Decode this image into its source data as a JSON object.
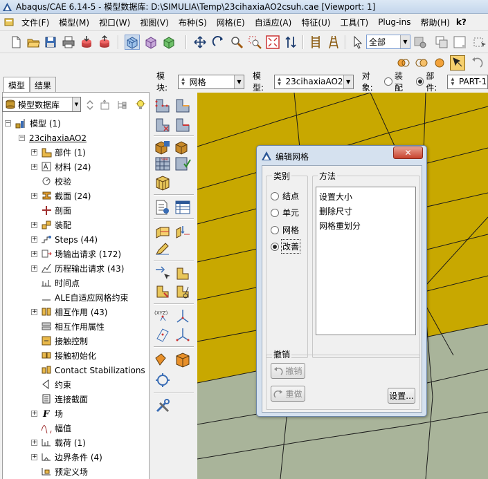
{
  "window": {
    "title": "Abaqus/CAE 6.14-5 - 模型数据库: D:\\SIMULIA\\Temp\\23cihaxiaAO2csuh.cae [Viewport: 1]"
  },
  "menu": {
    "items": [
      "文件(F)",
      "模型(M)",
      "视口(W)",
      "视图(V)",
      "布种(S)",
      "网格(E)",
      "自适应(A)",
      "特征(U)",
      "工具(T)",
      "Plug-ins",
      "帮助(H)"
    ],
    "whats_this": "k?"
  },
  "toolbar": {
    "selection_filter": "全部"
  },
  "left_tabs": [
    "模型",
    "结果"
  ],
  "tree_selector": "模型数据库",
  "tree": {
    "root": "模型 (1)",
    "model": "23cihaxiaAO2",
    "items": [
      {
        "label": "部件 (1)",
        "icon": "part-icon",
        "expandable": true
      },
      {
        "label": "材料 (24)",
        "icon": "material-icon",
        "expandable": true
      },
      {
        "label": "校验",
        "icon": "calibration-icon",
        "expandable": false
      },
      {
        "label": "截面 (24)",
        "icon": "section-icon",
        "expandable": true
      },
      {
        "label": "剖面",
        "icon": "profile-icon",
        "expandable": false
      },
      {
        "label": "装配",
        "icon": "assembly-icon",
        "expandable": true
      },
      {
        "label": "Steps (44)",
        "icon": "steps-icon",
        "expandable": true
      },
      {
        "label": "场输出请求 (172)",
        "icon": "field-output-icon",
        "expandable": true
      },
      {
        "label": "历程输出请求 (43)",
        "icon": "history-output-icon",
        "expandable": true
      },
      {
        "label": "时间点",
        "icon": "time-points-icon",
        "expandable": false
      },
      {
        "label": "ALE自适应网格约束",
        "icon": "ale-icon",
        "expandable": false
      },
      {
        "label": "相互作用  (43)",
        "icon": "interaction-icon",
        "expandable": true
      },
      {
        "label": "相互作用属性",
        "icon": "interaction-property-icon",
        "expandable": false
      },
      {
        "label": "接触控制",
        "icon": "contact-control-icon",
        "expandable": false
      },
      {
        "label": "接触初始化",
        "icon": "contact-init-icon",
        "expandable": false
      },
      {
        "label": "Contact Stabilizations",
        "icon": "contact-stabilization-icon",
        "expandable": false
      },
      {
        "label": "约束",
        "icon": "constraint-icon",
        "expandable": false
      },
      {
        "label": "连接截面",
        "icon": "connector-section-icon",
        "expandable": false
      },
      {
        "label": "场",
        "icon": "field-icon",
        "expandable": true
      },
      {
        "label": "幅值",
        "icon": "amplitude-icon",
        "expandable": false
      },
      {
        "label": "载荷 (1)",
        "icon": "load-icon",
        "expandable": true
      },
      {
        "label": "边界条件 (4)",
        "icon": "bc-icon",
        "expandable": true
      },
      {
        "label": "预定义场",
        "icon": "predefined-field-icon",
        "expandable": false
      }
    ]
  },
  "module_bar": {
    "module_label": "模块:",
    "module_value": "网格",
    "model_label": "模型:",
    "model_value": "23cihaxiaAO2",
    "object_label": "对象:",
    "assembly_label": "装配",
    "part_label": "部件:",
    "part_value": "PART-1"
  },
  "dialog": {
    "title": "编辑网格",
    "category_label": "类别",
    "categories": [
      {
        "label": "结点",
        "selected": false
      },
      {
        "label": "单元",
        "selected": false
      },
      {
        "label": "网格",
        "selected": false
      },
      {
        "label": "改善",
        "selected": true
      }
    ],
    "method_label": "方法",
    "methods": [
      "设置大小",
      "删除尺寸",
      "网格重划分"
    ],
    "undo_group_label": "撤销",
    "undo_button": "撤销",
    "redo_button": "重做",
    "settings_button": "设置..."
  },
  "colors": {
    "mesh_yellow": "#c8a800",
    "mesh_gray": "#a9b49a",
    "dialog_frame": "#d5e1ef",
    "close_red": "#c8432f"
  }
}
